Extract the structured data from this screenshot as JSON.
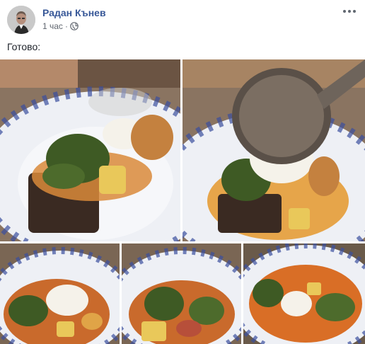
{
  "post": {
    "author_name": "Радан Кънев",
    "timestamp": "1 час",
    "separator": "·",
    "text": "Готово:"
  },
  "icons": {
    "avatar": "avatar-portrait-icon",
    "privacy": "globe-icon",
    "more": "ellipsis-icon"
  },
  "photos": [
    {
      "name": "photo-1",
      "subject": "soup with poached egg on bread, close-up"
    },
    {
      "name": "photo-2",
      "subject": "ladle serving soup over poached egg"
    },
    {
      "name": "photo-3",
      "subject": "soup bowl with egg"
    },
    {
      "name": "photo-4",
      "subject": "soup bowl with vegetables"
    },
    {
      "name": "photo-5",
      "subject": "soup bowl with kale and egg"
    }
  ],
  "colors": {
    "link_blue": "#385898",
    "meta_gray": "#616770",
    "text": "#1d2129",
    "plate_pattern": "#3a4f9e"
  }
}
